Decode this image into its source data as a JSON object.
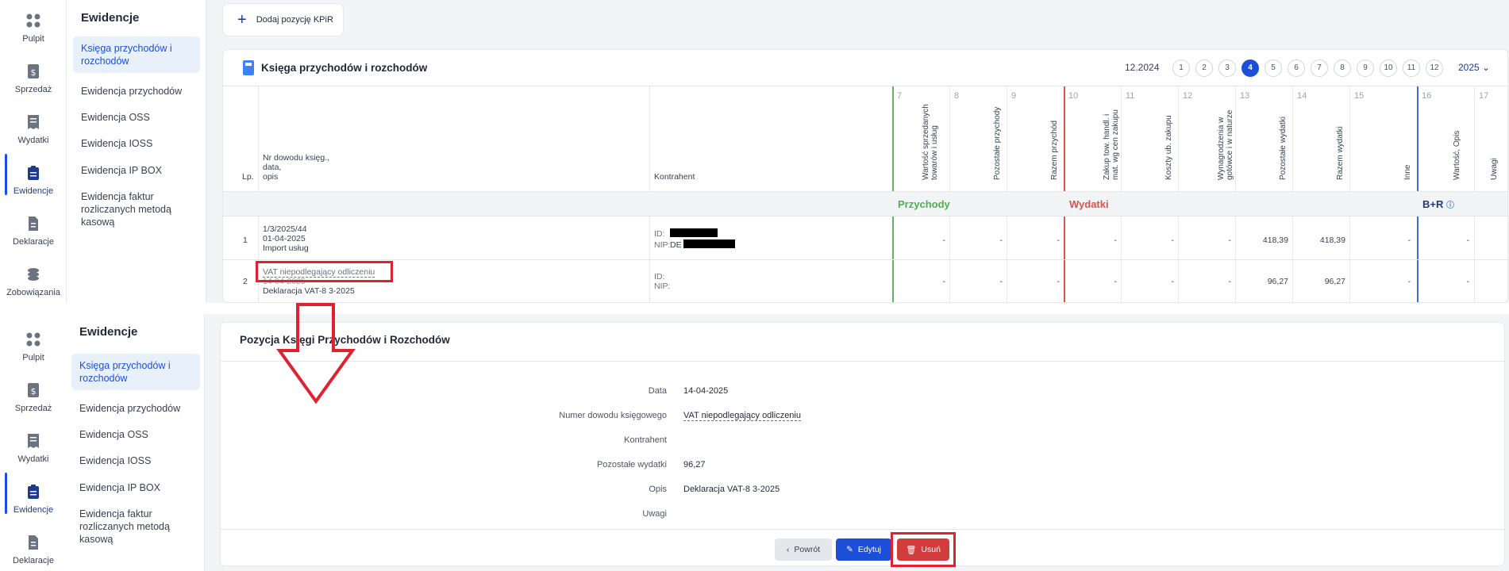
{
  "nav": {
    "icons_top": [
      {
        "label": "Pulpit",
        "icon": "grid-icon"
      },
      {
        "label": "Sprzedaż",
        "icon": "dollar-doc-icon"
      },
      {
        "label": "Wydatki",
        "icon": "receipt-icon"
      },
      {
        "label": "Ewidencje",
        "icon": "clipboard-icon"
      },
      {
        "label": "Deklaracje",
        "icon": "document-icon"
      },
      {
        "label": "Zobowiązania",
        "icon": "coins-icon"
      }
    ],
    "icons_bottom": [
      {
        "label": "Pulpit",
        "icon": "grid-icon"
      },
      {
        "label": "Sprzedaż",
        "icon": "dollar-doc-icon"
      },
      {
        "label": "Wydatki",
        "icon": "receipt-icon"
      },
      {
        "label": "Ewidencje",
        "icon": "clipboard-icon"
      },
      {
        "label": "Deklaracje",
        "icon": "document-icon"
      }
    ]
  },
  "subnav": {
    "title": "Ewidencje",
    "items": [
      "Księga przychodów i rozchodów",
      "Ewidencja przychodów",
      "Ewidencja OSS",
      "Ewidencja IOSS",
      "Ewidencja IP BOX",
      "Ewidencja faktur rozliczanych metodą kasową"
    ]
  },
  "toolbar": {
    "add_label": "Dodaj pozycję KPiR"
  },
  "book": {
    "title": "Księga przychodów i rozchodów",
    "period": "12.2024",
    "pages": [
      "1",
      "2",
      "3",
      "4",
      "5",
      "6",
      "7",
      "8",
      "9",
      "10",
      "11",
      "12"
    ],
    "active_page": "4",
    "year": "2025",
    "headers": {
      "lp": "Lp.",
      "doc": "Nr dowodu księg.,",
      "doc2": "data,",
      "doc3": "opis",
      "contractor": "Kontrahent",
      "c7": "Wartość sprzedanych towarów i usług",
      "c8": "Pozostałe przychody",
      "c9": "Razem przychód",
      "c10": "Zakup tow. handl. i mat. wg cen zakupu",
      "c11": "Koszty ub. zakupu",
      "c12": "Wynagrodzenia w gotówce i w naturze",
      "c13": "Pozostałe wydatki",
      "c14": "Razem wydatki",
      "c15": "Inne",
      "c16": "Wartość, Opis",
      "c17": "Uwagi"
    },
    "colnums": [
      "7",
      "8",
      "9",
      "10",
      "11",
      "12",
      "13",
      "14",
      "15",
      "16",
      "17"
    ],
    "groups": {
      "income": "Przychody",
      "expenses": "Wydatki",
      "br": "B+R"
    },
    "rows": [
      {
        "lp": "1",
        "doc": "1/3/2025/44",
        "date": "01-04-2025",
        "desc": "Import usług",
        "id_label": "ID:",
        "nip_label": "NIP:",
        "nip_prefix": "DE",
        "c13": "418,39",
        "c14": "418,39",
        "dash": "-"
      },
      {
        "lp": "2",
        "doc": "VAT niepodlegający odliczeniu",
        "date": "14-04-2025",
        "desc": "Deklaracja VAT-8 3-2025",
        "id_label": "ID:",
        "nip_label": "NIP:",
        "nip_prefix": "",
        "c13": "96,27",
        "c14": "96,27",
        "dash": "-"
      }
    ]
  },
  "detail": {
    "title": "Pozycja Księgi Przychodów i Rozchodów",
    "fields": [
      {
        "label": "Data",
        "value": "14-04-2025"
      },
      {
        "label": "Numer dowodu księgowego",
        "value": "VAT niepodlegający odliczeniu"
      },
      {
        "label": "Kontrahent",
        "value": ""
      },
      {
        "label": "Pozostałe wydatki",
        "value": "96,27"
      },
      {
        "label": "Opis",
        "value": "Deklaracja VAT-8 3-2025"
      },
      {
        "label": "Uwagi",
        "value": ""
      }
    ],
    "buttons": {
      "back": "Powrót",
      "edit": "Edytuj",
      "delete": "Usuń"
    }
  },
  "colors": {
    "accent": "#1d4ed8",
    "income": "#4caf50",
    "expense": "#d9534f",
    "highlight": "#e0212f"
  }
}
